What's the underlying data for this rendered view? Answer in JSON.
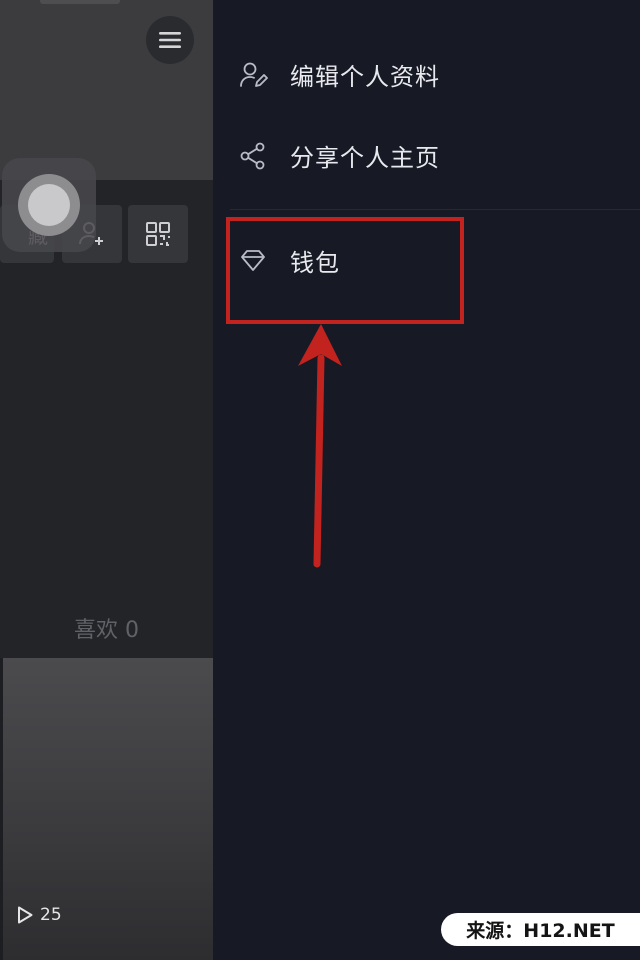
{
  "profile_page": {
    "favorites_partial_label": "藏",
    "likes_label": "喜欢 0",
    "video": {
      "play_count": "25"
    }
  },
  "drawer": {
    "items": [
      {
        "label": "编辑个人资料",
        "icon": "edit-profile-icon"
      },
      {
        "label": "分享个人主页",
        "icon": "share-icon"
      },
      {
        "label": "钱包",
        "icon": "diamond-wallet-icon"
      }
    ]
  },
  "annotation": {
    "color": "#c2231f"
  },
  "watermark": {
    "text": "来源：H12.NET"
  }
}
